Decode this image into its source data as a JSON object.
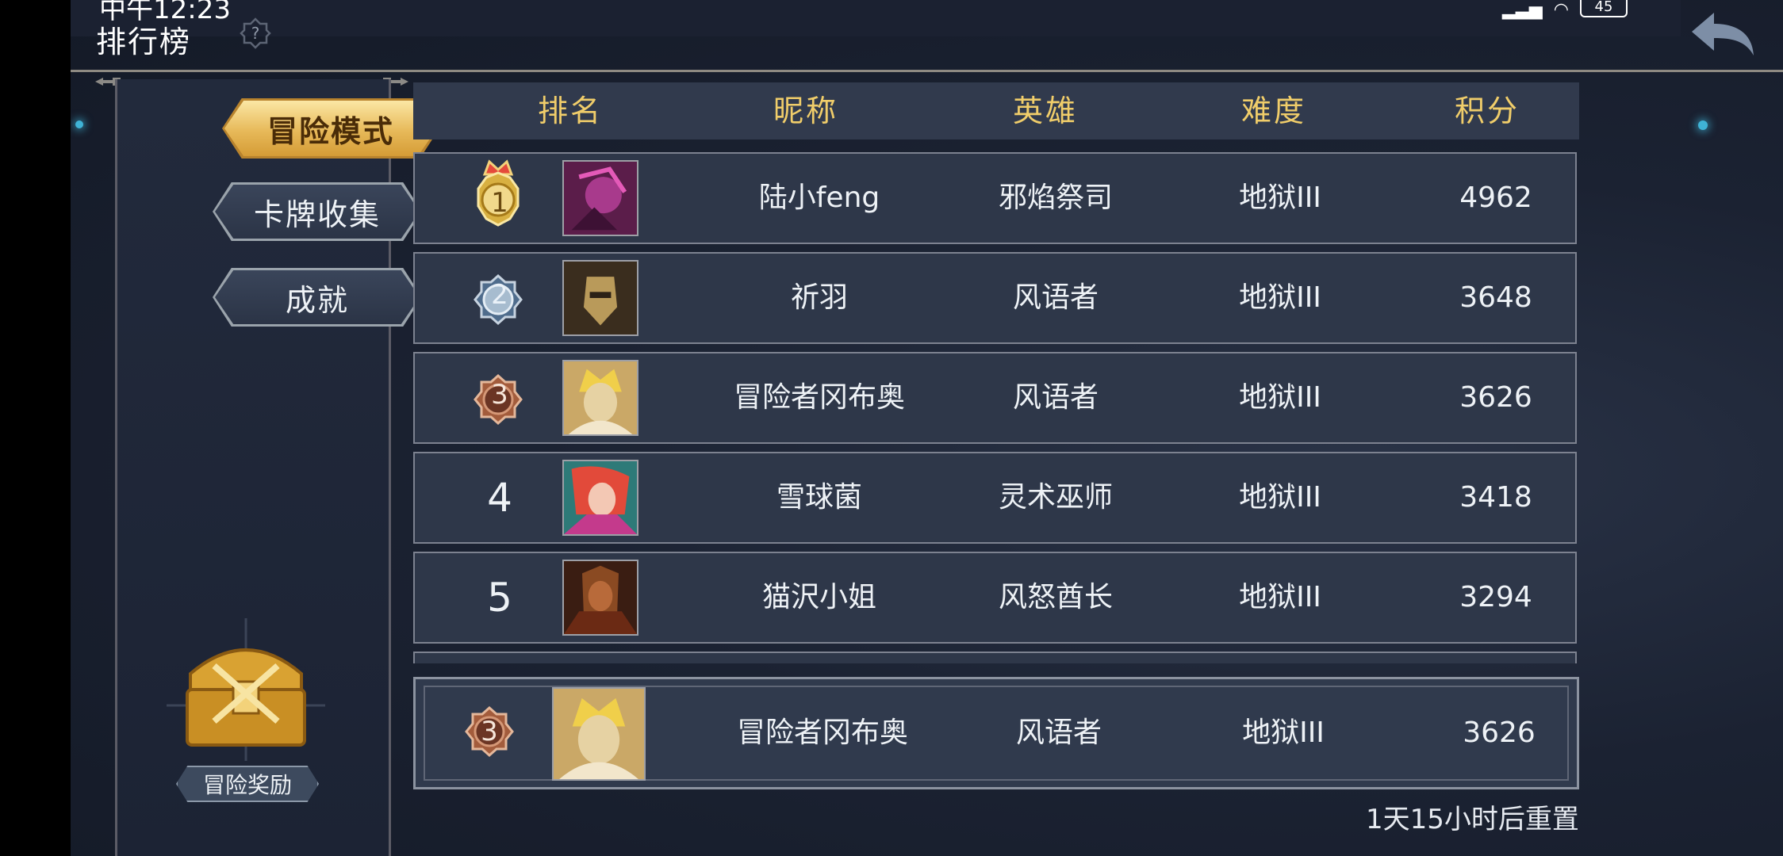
{
  "status": {
    "time": "中午12:23",
    "battery": "45"
  },
  "header": {
    "title": "排行榜"
  },
  "sidebar": {
    "modes": [
      {
        "label": "冒险模式",
        "active": true
      },
      {
        "label": "卡牌收集",
        "active": false
      },
      {
        "label": "成就",
        "active": false
      }
    ],
    "reward_label": "冒险奖励"
  },
  "table": {
    "columns": [
      "排名",
      "昵称",
      "英雄",
      "难度",
      "积分"
    ],
    "rows": [
      {
        "rank": "1",
        "name": "陆小feng",
        "hero": "邪焰祭司",
        "difficulty": "地狱III",
        "score": "4962",
        "medal": "gold",
        "avatar": "purple-demon-portrait"
      },
      {
        "rank": "2",
        "name": "祈羽",
        "hero": "风语者",
        "difficulty": "地狱III",
        "score": "3648",
        "medal": "silver",
        "avatar": "masked-warrior-portrait"
      },
      {
        "rank": "3",
        "name": "冒险者冈布奥",
        "hero": "风语者",
        "difficulty": "地狱III",
        "score": "3626",
        "medal": "bronze",
        "avatar": "blond-hero-portrait"
      },
      {
        "rank": "4",
        "name": "雪球菌",
        "hero": "灵术巫师",
        "difficulty": "地狱III",
        "score": "3418",
        "medal": "none",
        "avatar": "red-haired-mage-portrait"
      },
      {
        "rank": "5",
        "name": "猫沢小姐",
        "hero": "风怒酋长",
        "difficulty": "地狱III",
        "score": "3294",
        "medal": "none",
        "avatar": "tribal-chief-portrait"
      }
    ]
  },
  "self": {
    "rank": "3",
    "name": "冒险者冈布奥",
    "hero": "风语者",
    "difficulty": "地狱III",
    "score": "3626",
    "medal": "bronze",
    "avatar": "blond-hero-portrait"
  },
  "reset_text": "1天15小时后重置",
  "colors": {
    "gold_text": "#f0cd6a",
    "active_tab": "#e7b959",
    "row_bg": "#2e3749"
  }
}
